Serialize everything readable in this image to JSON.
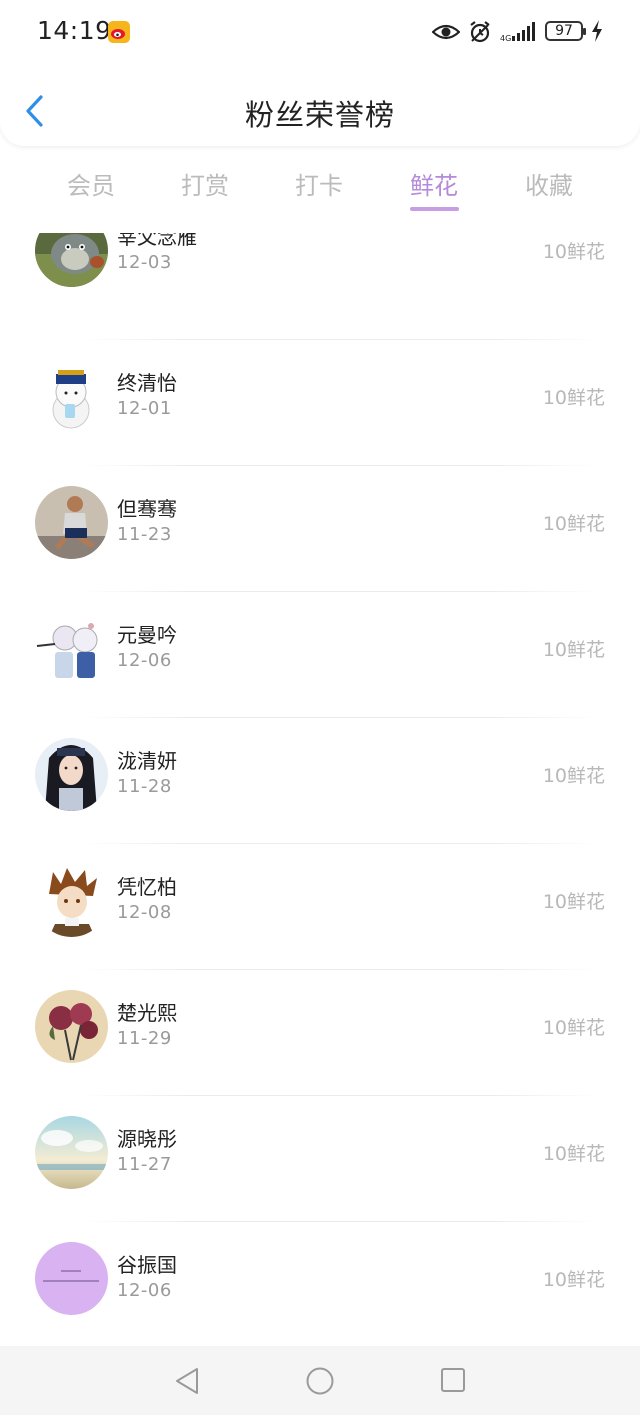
{
  "status": {
    "time": "14:19",
    "battery": "97",
    "icons": [
      "weibo-icon",
      "eye-icon",
      "alarm-icon",
      "signal-icon",
      "battery-icon",
      "charging-bolt-icon"
    ]
  },
  "header": {
    "title": "粉丝荣誉榜",
    "back_icon": "chevron-left-icon"
  },
  "tabs": [
    {
      "label": "会员",
      "active": false
    },
    {
      "label": "打赏",
      "active": false
    },
    {
      "label": "打卡",
      "active": false
    },
    {
      "label": "鲜花",
      "active": true
    },
    {
      "label": "收藏",
      "active": false
    }
  ],
  "colors": {
    "accent": "#b48ad9",
    "inactive_tab": "#bbbbbb",
    "amount": "#b8b8b8",
    "date": "#9a9a9a"
  },
  "list": [
    {
      "name": "宰父念雁",
      "date": "12-03",
      "amount": "10鲜花",
      "avatar": "totoro-avatar"
    },
    {
      "name": "终清怡",
      "date": "12-01",
      "amount": "10鲜花",
      "avatar": "cartoon-qing-official-avatar"
    },
    {
      "name": "但骞骞",
      "date": "11-23",
      "amount": "10鲜花",
      "avatar": "runner-avatar"
    },
    {
      "name": "元曼吟",
      "date": "12-06",
      "amount": "10鲜花",
      "avatar": "anime-girls-avatar"
    },
    {
      "name": "泷清妍",
      "date": "11-28",
      "amount": "10鲜花",
      "avatar": "girl-portrait-avatar"
    },
    {
      "name": "凭忆柏",
      "date": "12-08",
      "amount": "10鲜花",
      "avatar": "anime-boy-avatar"
    },
    {
      "name": "楚光熙",
      "date": "11-29",
      "amount": "10鲜花",
      "avatar": "roses-avatar"
    },
    {
      "name": "源晓彤",
      "date": "11-27",
      "amount": "10鲜花",
      "avatar": "sky-sea-avatar"
    },
    {
      "name": "谷振国",
      "date": "12-06",
      "amount": "10鲜花",
      "avatar": "purple-text-avatar"
    }
  ],
  "navbar": {
    "icons": [
      "nav-back-icon",
      "nav-home-icon",
      "nav-recent-icon"
    ]
  }
}
